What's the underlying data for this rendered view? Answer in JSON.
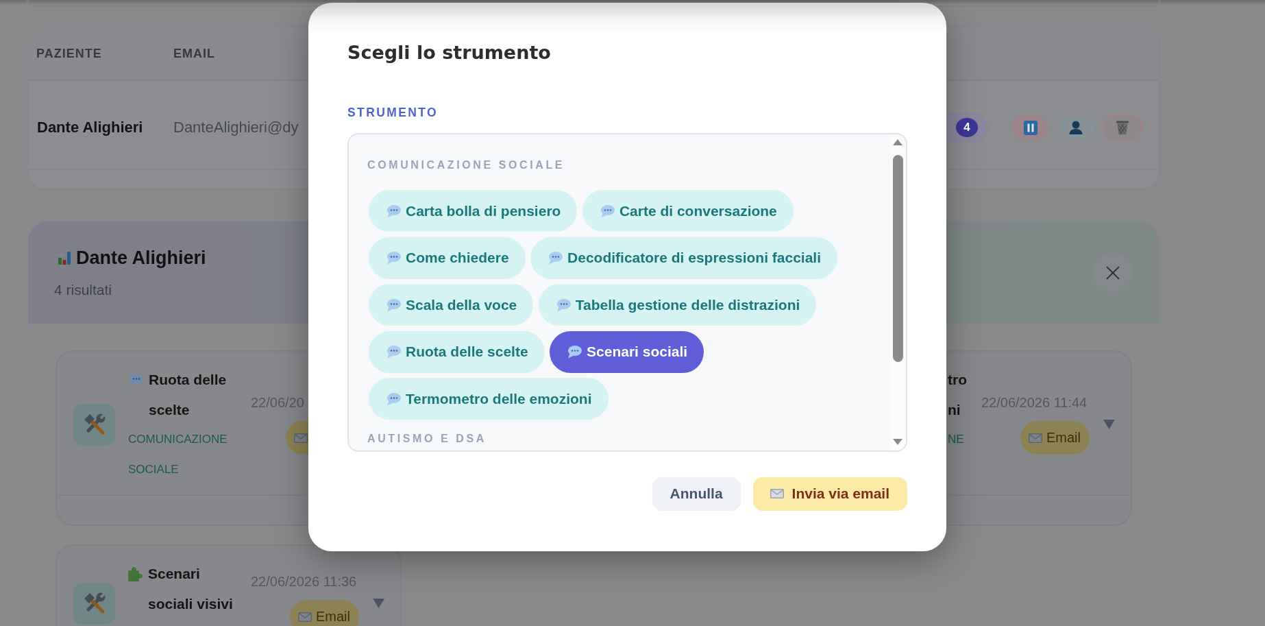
{
  "table": {
    "columns": [
      "PAZIENTE",
      "EMAIL"
    ],
    "rows": [
      {
        "patient": "Dante Alighieri",
        "email": "DanteAlighieri@dy",
        "count": "4",
        "actions": [
          {
            "kind": "pause"
          },
          {
            "kind": "profile"
          },
          {
            "kind": "delete"
          }
        ]
      }
    ]
  },
  "results": {
    "title": "Dante Alighieri",
    "subtitle": "4 risultati",
    "cards": [
      {
        "kind": "speech",
        "title": "Ruota delle scelte",
        "category": "COMUNICAZIONE SOCIALE",
        "date": "22/06/20"
      },
      {
        "kind": "fragment",
        "title_fragments": [
          "tro",
          "ni"
        ],
        "category_fragments": [
          "NE"
        ],
        "date": "22/06/2026 11:44",
        "email_label": "Email"
      },
      {
        "kind": "puzzle",
        "title": "Scenari sociali visivi",
        "date": "22/06/2026 11:36",
        "email_label": "Email"
      }
    ]
  },
  "modal": {
    "title": "Scegli lo strumento",
    "field_label": "STRUMENTO",
    "groups": [
      {
        "heading": "COMUNICAZIONE SOCIALE",
        "items": [
          {
            "label": "Carta bolla di pensiero",
            "selected": false
          },
          {
            "label": "Carte di conversazione",
            "selected": false
          },
          {
            "label": "Come chiedere",
            "selected": false
          },
          {
            "label": "Decodificatore di espressioni facciali",
            "selected": false
          },
          {
            "label": "Scala della voce",
            "selected": false
          },
          {
            "label": "Tabella gestione delle distrazioni",
            "selected": false
          },
          {
            "label": "Ruota delle scelte",
            "selected": false
          },
          {
            "label": "Scenari sociali",
            "selected": true
          },
          {
            "label": "Termometro delle emozioni",
            "selected": false
          }
        ]
      },
      {
        "heading": "AUTISMO E DSA"
      }
    ],
    "buttons": [
      {
        "kind": "cancel",
        "label": "Annulla"
      },
      {
        "kind": "send",
        "label": "Invia via email"
      }
    ]
  }
}
